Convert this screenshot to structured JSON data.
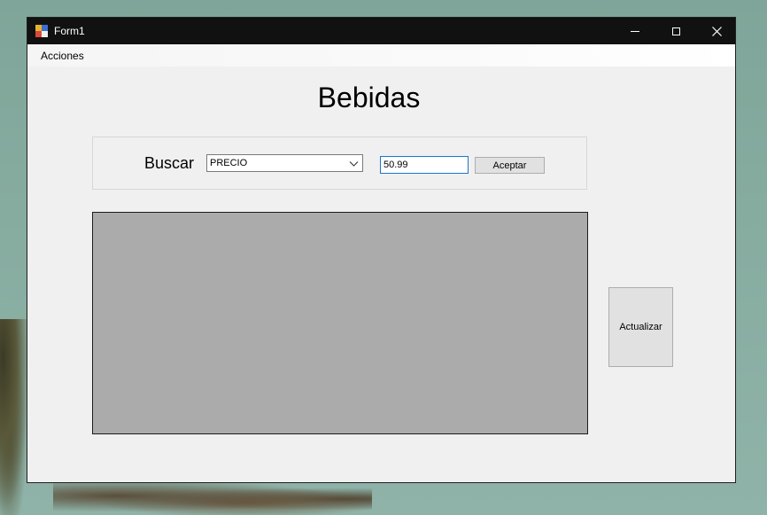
{
  "window": {
    "title": "Form1"
  },
  "menu": {
    "items": [
      {
        "label": "Acciones"
      }
    ]
  },
  "main": {
    "heading": "Bebidas",
    "search": {
      "label": "Buscar",
      "combo_value": "PRECIO",
      "input_value": "50.99",
      "accept_label": "Aceptar"
    },
    "refresh_label": "Actualizar"
  },
  "icons": {
    "app": "app-icon",
    "minimize": "minimize-icon",
    "maximize": "maximize-icon",
    "close": "close-icon",
    "dropdown": "chevron-down-icon"
  },
  "colors": {
    "titlebar": "#111111",
    "window_bg": "#f0f0f0",
    "grid_bg": "#ababab",
    "input_focus_border": "#1a76d2",
    "button_bg": "#e1e1e1"
  }
}
